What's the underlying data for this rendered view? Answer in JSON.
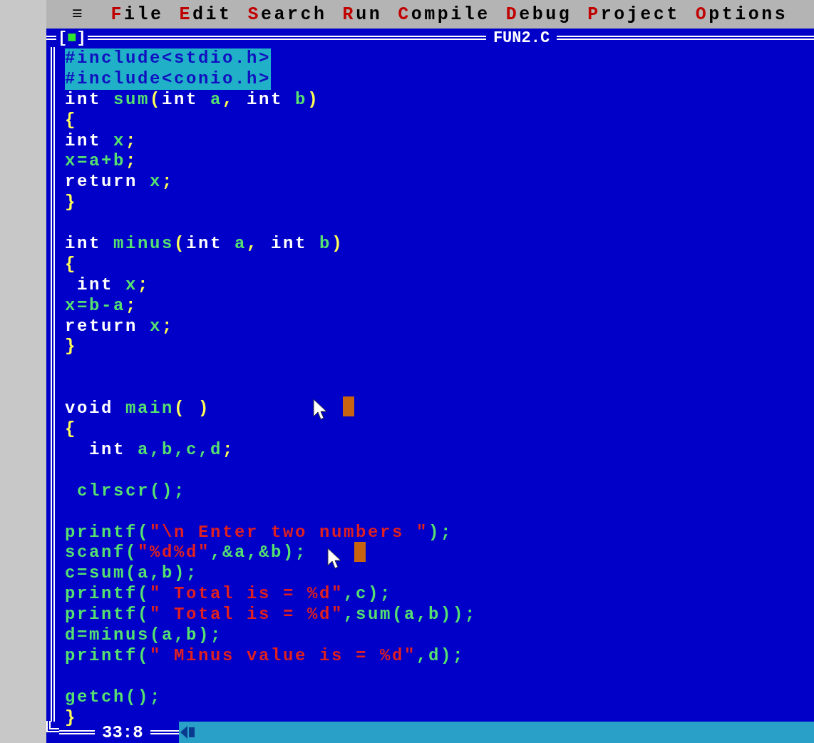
{
  "menu_bar": {
    "system_menu": "≡",
    "items": [
      {
        "label": "File"
      },
      {
        "label": "Edit"
      },
      {
        "label": "Search"
      },
      {
        "label": "Run"
      },
      {
        "label": "Compile"
      },
      {
        "label": "Debug"
      },
      {
        "label": "Project"
      },
      {
        "label": "Options"
      }
    ]
  },
  "editor": {
    "close_box": "[■]",
    "title": "FUN2.C",
    "blocks": [
      {
        "blank_after": true,
        "double_blank": false,
        "lines": [
          [
            {
              "text": "#include<stdio.h>",
              "kind": "selected"
            }
          ],
          [
            {
              "text": "#include<conio.h>",
              "kind": "selected"
            }
          ],
          [
            {
              "text": "int ",
              "kind": "keyword"
            },
            {
              "text": "sum",
              "kind": "ident"
            },
            {
              "text": "(",
              "kind": "punct"
            },
            {
              "text": "int ",
              "kind": "keyword"
            },
            {
              "text": "a",
              "kind": "ident"
            },
            {
              "text": ", ",
              "kind": "punct"
            },
            {
              "text": "int ",
              "kind": "keyword"
            },
            {
              "text": "b",
              "kind": "ident"
            },
            {
              "text": ")",
              "kind": "punct"
            }
          ],
          [
            {
              "text": "{",
              "kind": "punct"
            }
          ],
          [
            {
              "text": "int ",
              "kind": "keyword"
            },
            {
              "text": "x",
              "kind": "ident"
            },
            {
              "text": ";",
              "kind": "punct"
            }
          ],
          [
            {
              "text": "x=a+b",
              "kind": "ident"
            },
            {
              "text": ";",
              "kind": "punct"
            }
          ],
          [
            {
              "text": "return ",
              "kind": "keyword"
            },
            {
              "text": "x",
              "kind": "ident"
            },
            {
              "text": ";",
              "kind": "punct"
            }
          ],
          [
            {
              "text": "}",
              "kind": "punct"
            }
          ]
        ]
      },
      {
        "blank_after": true,
        "double_blank": true,
        "lines": [
          [
            {
              "text": "int ",
              "kind": "keyword"
            },
            {
              "text": "minus",
              "kind": "ident"
            },
            {
              "text": "(",
              "kind": "punct"
            },
            {
              "text": "int ",
              "kind": "keyword"
            },
            {
              "text": "a",
              "kind": "ident"
            },
            {
              "text": ", ",
              "kind": "punct"
            },
            {
              "text": "int ",
              "kind": "keyword"
            },
            {
              "text": "b",
              "kind": "ident"
            },
            {
              "text": ")",
              "kind": "punct"
            }
          ],
          [
            {
              "text": "{",
              "kind": "punct"
            }
          ],
          [
            {
              "text": " int ",
              "kind": "keyword"
            },
            {
              "text": "x",
              "kind": "ident"
            },
            {
              "text": ";",
              "kind": "punct"
            }
          ],
          [
            {
              "text": "x=b-a",
              "kind": "ident"
            },
            {
              "text": ";",
              "kind": "punct"
            }
          ],
          [
            {
              "text": "return ",
              "kind": "keyword"
            },
            {
              "text": "x",
              "kind": "ident"
            },
            {
              "text": ";",
              "kind": "punct"
            }
          ],
          [
            {
              "text": "}",
              "kind": "punct"
            }
          ]
        ]
      },
      {
        "blank_after": true,
        "double_blank": false,
        "lines": [
          [
            {
              "text": "void ",
              "kind": "keyword"
            },
            {
              "text": "main",
              "kind": "ident"
            },
            {
              "text": "( )",
              "kind": "punct"
            }
          ],
          [
            {
              "text": "{",
              "kind": "punct"
            }
          ],
          [
            {
              "text": "  int ",
              "kind": "keyword"
            },
            {
              "text": "a,b,c,d",
              "kind": "ident"
            },
            {
              "text": ";",
              "kind": "punct"
            }
          ]
        ]
      },
      {
        "blank_after": true,
        "double_blank": false,
        "lines": [
          [
            {
              "text": " clrscr();",
              "kind": "ident"
            }
          ]
        ]
      },
      {
        "blank_after": true,
        "double_blank": false,
        "lines": [
          [
            {
              "text": "printf(",
              "kind": "ident"
            },
            {
              "text": "\"\\n Enter two numbers \"",
              "kind": "string"
            },
            {
              "text": ");",
              "kind": "ident"
            }
          ],
          [
            {
              "text": "scanf(",
              "kind": "ident"
            },
            {
              "text": "\"%d%d\"",
              "kind": "string"
            },
            {
              "text": ",&a,&b);",
              "kind": "ident"
            }
          ],
          [
            {
              "text": "c=sum(a,b);",
              "kind": "ident"
            }
          ],
          [
            {
              "text": "printf(",
              "kind": "ident"
            },
            {
              "text": "\" Total is = %d\"",
              "kind": "string"
            },
            {
              "text": ",c);",
              "kind": "ident"
            }
          ],
          [
            {
              "text": "printf(",
              "kind": "ident"
            },
            {
              "text": "\" Total is = %d\"",
              "kind": "string"
            },
            {
              "text": ",sum(a,b));",
              "kind": "ident"
            }
          ],
          [
            {
              "text": "d=minus(a,b);",
              "kind": "ident"
            }
          ],
          [
            {
              "text": "printf(",
              "kind": "ident"
            },
            {
              "text": "\" Minus value is = %d\"",
              "kind": "string"
            },
            {
              "text": ",d);",
              "kind": "ident"
            }
          ]
        ]
      },
      {
        "blank_after": false,
        "double_blank": false,
        "lines": [
          [
            {
              "text": "getch();",
              "kind": "ident"
            }
          ],
          [
            {
              "text": "}",
              "kind": "punct"
            }
          ]
        ]
      }
    ],
    "position": "33:8"
  }
}
